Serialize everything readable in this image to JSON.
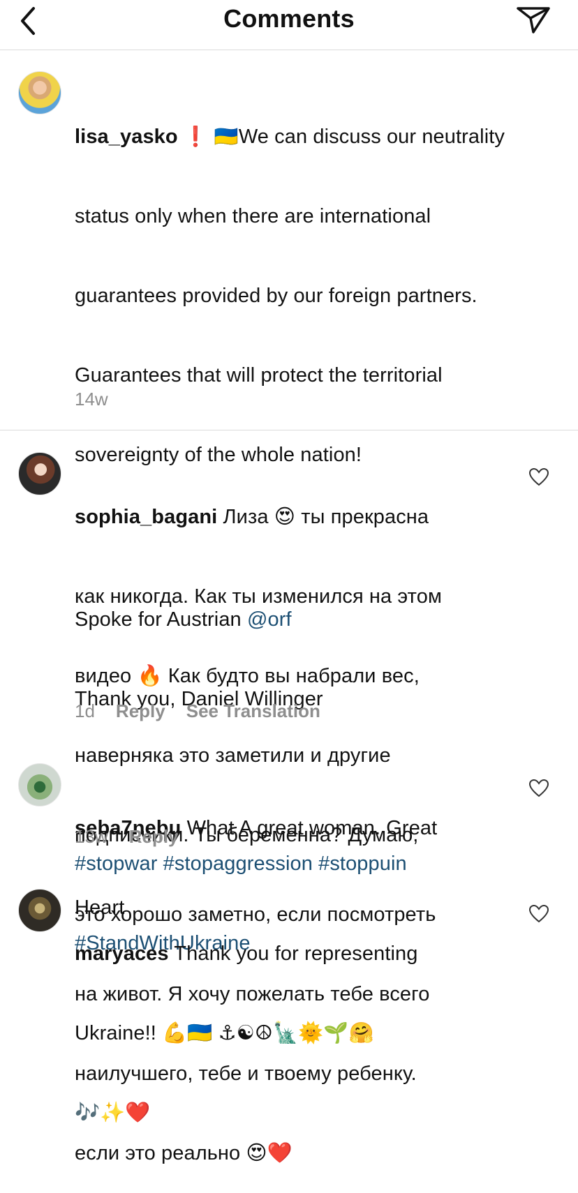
{
  "header": {
    "title": "Comments",
    "back_icon": "chevron-left-icon",
    "send_icon": "paper-plane-icon"
  },
  "caption": {
    "username": "lisa_yasko",
    "prefix_emoji": "❗ 🇺🇦",
    "line1": "We can discuss our neutrality",
    "line2": "status only when there are international",
    "line3": "guarantees provided by our foreign partners.",
    "line4": "Guarantees that will protect the territorial",
    "line5": "sovereignty of the whole nation!",
    "spoke": "Spoke for Austrian ",
    "mention": "@orf",
    "thanks": "Thank you, Daniel Willinger",
    "hashtags1": "#stopwar #stopaggression #stoppuin",
    "hashtags2": "#StandWithUkraine",
    "time": "14w"
  },
  "comments": [
    {
      "username": "sophia_bagani",
      "lines": [
        "Лиза 😍 ты прекрасна",
        "как никогда. Как ты изменился на этом",
        "видео 🔥 Как будто вы набрали вес,",
        "наверняка это заметили и другие",
        "подписчики. Ты беременна? Думаю,",
        "это хорошо заметно, если посмотреть",
        "на живот. Я хочу пожелать тебе всего",
        "наилучшего, тебе и твоему ребенку.",
        "если это реально 😍❤️"
      ],
      "time": "1d",
      "reply": "Reply",
      "translate": "See Translation"
    },
    {
      "username": "seba7nebu",
      "lines": [
        "What A great woman. Great",
        "Heart"
      ],
      "time": "13w",
      "reply": "Reply"
    },
    {
      "username": "maryaces",
      "lines": [
        "Thank you for representing",
        "Ukraine!! 💪🇺🇦 ⚓☯☮🗽🌞🌱🤗",
        "🎶✨❤️"
      ]
    }
  ],
  "colors": {
    "link": "#1c4f73",
    "meta": "#8e8e8e",
    "divider": "#dbdbdb"
  }
}
